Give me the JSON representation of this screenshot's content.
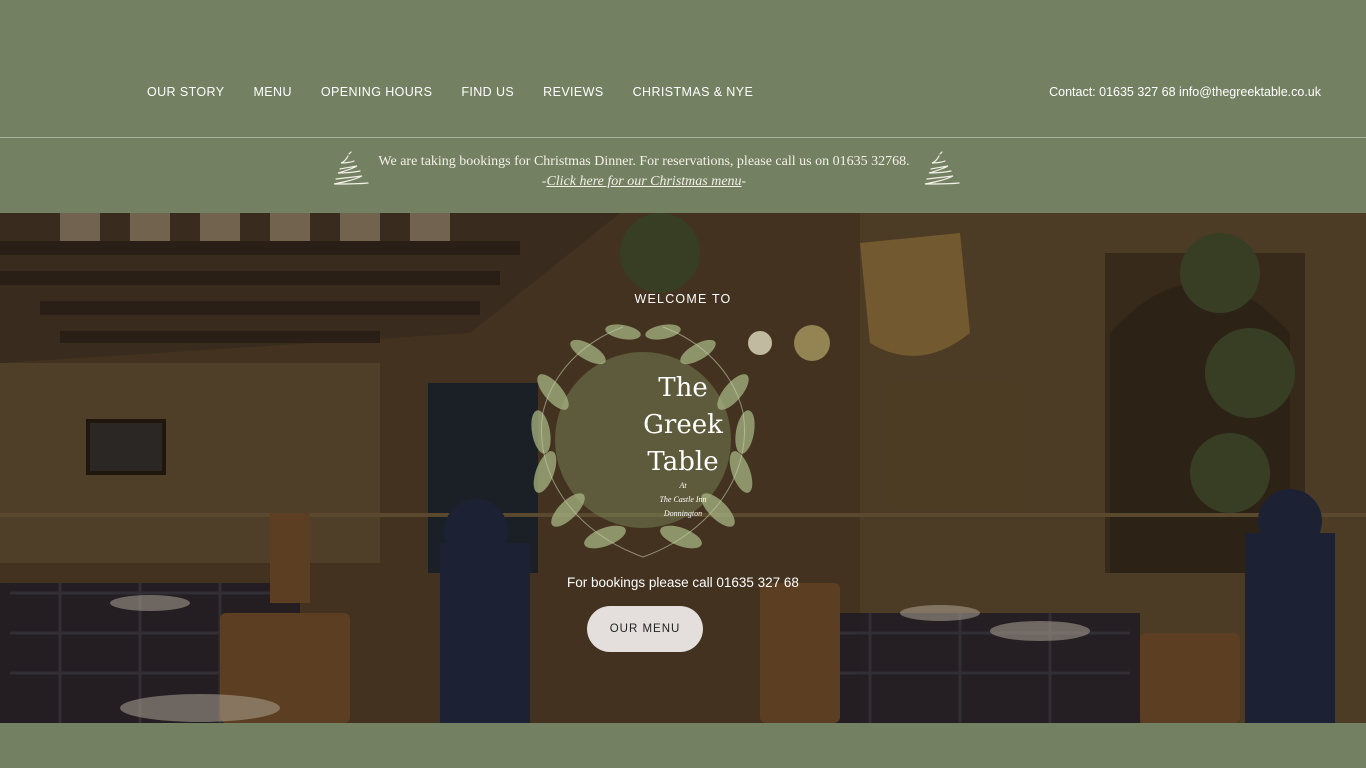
{
  "nav": {
    "items": [
      "OUR STORY",
      "MENU",
      "OPENING HOURS",
      "FIND US",
      "REVIEWS",
      "CHRISTMAS & NYE"
    ]
  },
  "contact": {
    "text": "Contact:  01635 327 68 info@thegreektable.co.uk"
  },
  "banner": {
    "line1": "We are taking bookings for Christmas Dinner.  For reservations, please call us on 01635 32768.",
    "link_prefix": "-",
    "link_text": "Click here for our Christmas menu",
    "link_suffix": "-"
  },
  "hero": {
    "welcome": "WELCOME TO",
    "logo_line1": "The",
    "logo_line2": "Greek",
    "logo_line3": "Table",
    "logo_sub1": "At",
    "logo_sub2": "The Castle Inn",
    "logo_sub3": "Donnington",
    "booking": "For bookings please call 01635 327 68",
    "menu_button": "OUR MENU"
  },
  "colors": {
    "brand_green": "#738162",
    "button_bg": "#e4dfdc"
  },
  "icons": {
    "banner_left": "christmas-tree-icon",
    "banner_right": "christmas-tree-icon",
    "logo": "olive-wreath-icon"
  }
}
